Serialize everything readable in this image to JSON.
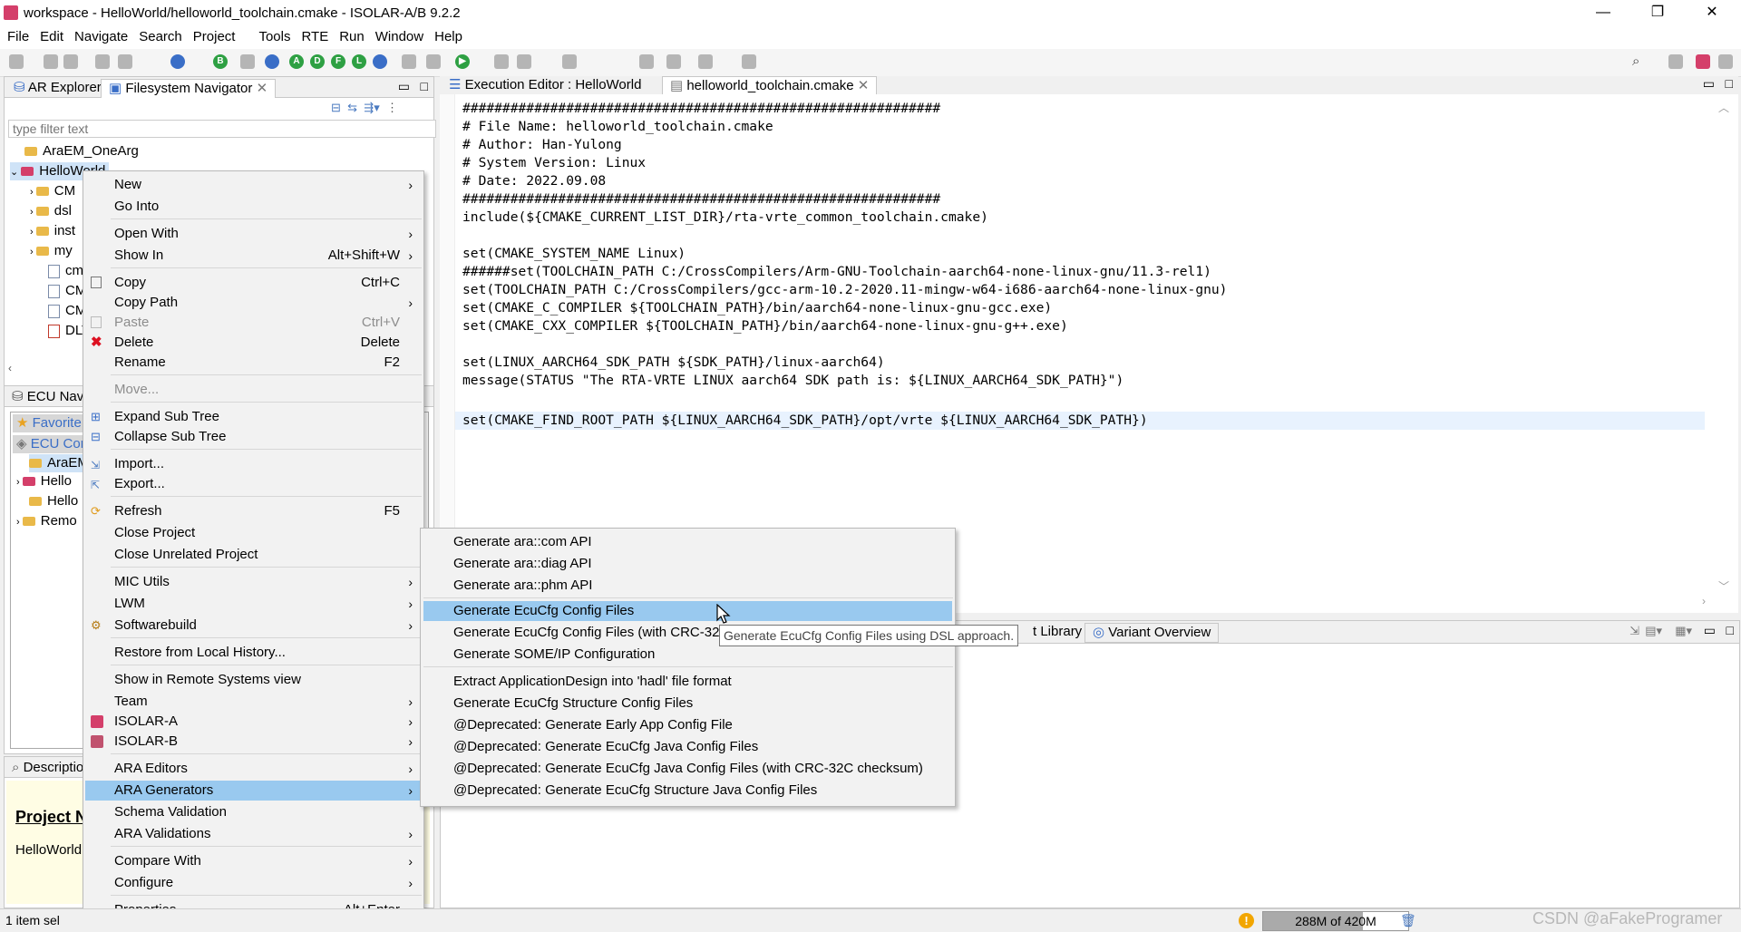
{
  "window": {
    "title": "workspace - HelloWorld/helloworld_toolchain.cmake - ISOLAR-A/B 9.2.2",
    "minimize": "—",
    "maximize": "❐",
    "close": "✕"
  },
  "menubar": [
    "File",
    "Edit",
    "Navigate",
    "Search",
    "Project",
    "Tools",
    "RTE",
    "Run",
    "Window",
    "Help"
  ],
  "left_top_panel": {
    "tabs": [
      "AR Explorer",
      "Filesystem Navigator"
    ],
    "filter_placeholder": "type filter text",
    "tree": [
      "AraEM_OneArg",
      "HelloWorld",
      "CM",
      "dsl",
      "inst",
      "my",
      "cm",
      "CM",
      "CM",
      "DLT"
    ]
  },
  "ecu_panel": {
    "title": "ECU Navi",
    "rows": [
      "Favorite",
      "ECU Cor",
      "AraEM",
      "Hello",
      "Hello",
      "Remo"
    ]
  },
  "desc_panel": {
    "title": "Descriptio",
    "heading": "Project N",
    "value": "HelloWorld"
  },
  "editor": {
    "tabs": [
      "Execution Editor : HelloWorld",
      "helloworld_toolchain.cmake"
    ],
    "lines": [
      "############################################################",
      "# File Name: helloworld_toolchain.cmake",
      "# Author: Han-Yulong",
      "# System Version: Linux",
      "# Date: 2022.09.08",
      "############################################################",
      "include(${CMAKE_CURRENT_LIST_DIR}/rta-vrte_common_toolchain.cmake)",
      "",
      "set(CMAKE_SYSTEM_NAME Linux)",
      "######set(TOOLCHAIN_PATH C:/CrossCompilers/Arm-GNU-Toolchain-aarch64-none-linux-gnu/11.3-rel1)",
      "set(TOOLCHAIN_PATH C:/CrossCompilers/gcc-arm-10.2-2020.11-mingw-w64-i686-aarch64-none-linux-gnu)",
      "set(CMAKE_C_COMPILER ${TOOLCHAIN_PATH}/bin/aarch64-none-linux-gnu-gcc.exe)",
      "set(CMAKE_CXX_COMPILER ${TOOLCHAIN_PATH}/bin/aarch64-none-linux-gnu-g++.exe)",
      "",
      "set(LINUX_AARCH64_SDK_PATH ${SDK_PATH}/linux-aarch64)",
      "message(STATUS \"The RTA-VRTE LINUX aarch64 SDK path is: ${LINUX_AARCH64_SDK_PATH}\")",
      "",
      "set(CMAKE_FIND_ROOT_PATH ${LINUX_AARCH64_SDK_PATH}/opt/vrte ${LINUX_AARCH64_SDK_PATH})"
    ]
  },
  "bottom_panel": {
    "tabs": [
      "t Library",
      "Variant Overview"
    ]
  },
  "context_menu": [
    {
      "label": "New",
      "arrow": "›"
    },
    {
      "label": "Go Into"
    },
    {
      "label": "Open With",
      "arrow": "›"
    },
    {
      "label": "Show In",
      "shortcut": "Alt+Shift+W",
      "arrow": "›"
    },
    {
      "label": "Copy",
      "shortcut": "Ctrl+C"
    },
    {
      "label": "Copy Path",
      "arrow": "›"
    },
    {
      "label": "Paste",
      "shortcut": "Ctrl+V"
    },
    {
      "label": "Delete",
      "shortcut": "Delete"
    },
    {
      "label": "Rename",
      "shortcut": "F2"
    },
    {
      "label": "Move..."
    },
    {
      "label": "Expand Sub Tree"
    },
    {
      "label": "Collapse Sub Tree"
    },
    {
      "label": "Import..."
    },
    {
      "label": "Export..."
    },
    {
      "label": "Refresh",
      "shortcut": "F5"
    },
    {
      "label": "Close Project"
    },
    {
      "label": "Close Unrelated Project"
    },
    {
      "label": "MIC Utils",
      "arrow": "›"
    },
    {
      "label": "LWM",
      "arrow": "›"
    },
    {
      "label": "Softwarebuild",
      "arrow": "›"
    },
    {
      "label": "Restore from Local History..."
    },
    {
      "label": "Show in Remote Systems view"
    },
    {
      "label": "Team",
      "arrow": "›"
    },
    {
      "label": "ISOLAR-A",
      "arrow": "›"
    },
    {
      "label": "ISOLAR-B",
      "arrow": "›"
    },
    {
      "label": "ARA Editors",
      "arrow": "›"
    },
    {
      "label": "ARA Generators",
      "arrow": "›"
    },
    {
      "label": "Schema Validation"
    },
    {
      "label": "ARA Validations",
      "arrow": "›"
    },
    {
      "label": "Compare With",
      "arrow": "›"
    },
    {
      "label": "Configure",
      "arrow": "›"
    },
    {
      "label": "Properties",
      "shortcut": "Alt+Enter"
    }
  ],
  "submenu": [
    "Generate ara::com API",
    "Generate ara::diag API",
    "Generate ara::phm API",
    "Generate EcuCfg Config Files",
    "Generate EcuCfg Config Files (with CRC-32C",
    "Generate SOME/IP Configuration",
    "Extract ApplicationDesign into 'hadl' file format",
    "Generate EcuCfg Structure Config Files",
    "@Deprecated: Generate Early App Config File",
    "@Deprecated: Generate EcuCfg Java Config Files",
    "@Deprecated: Generate EcuCfg Java Config Files (with CRC-32C checksum)",
    "@Deprecated: Generate EcuCfg Structure Java Config Files"
  ],
  "tooltip": "Generate EcuCfg Config Files using DSL approach.",
  "statusbar": {
    "selection": "1 item sel",
    "memory": "288M of 420M",
    "watermark": "CSDN @aFakeProgramer"
  },
  "colors": {
    "highlight": "#99c9ef",
    "accent_blue": "#3a6ec7",
    "heap_bar": "#aaaaaa"
  }
}
